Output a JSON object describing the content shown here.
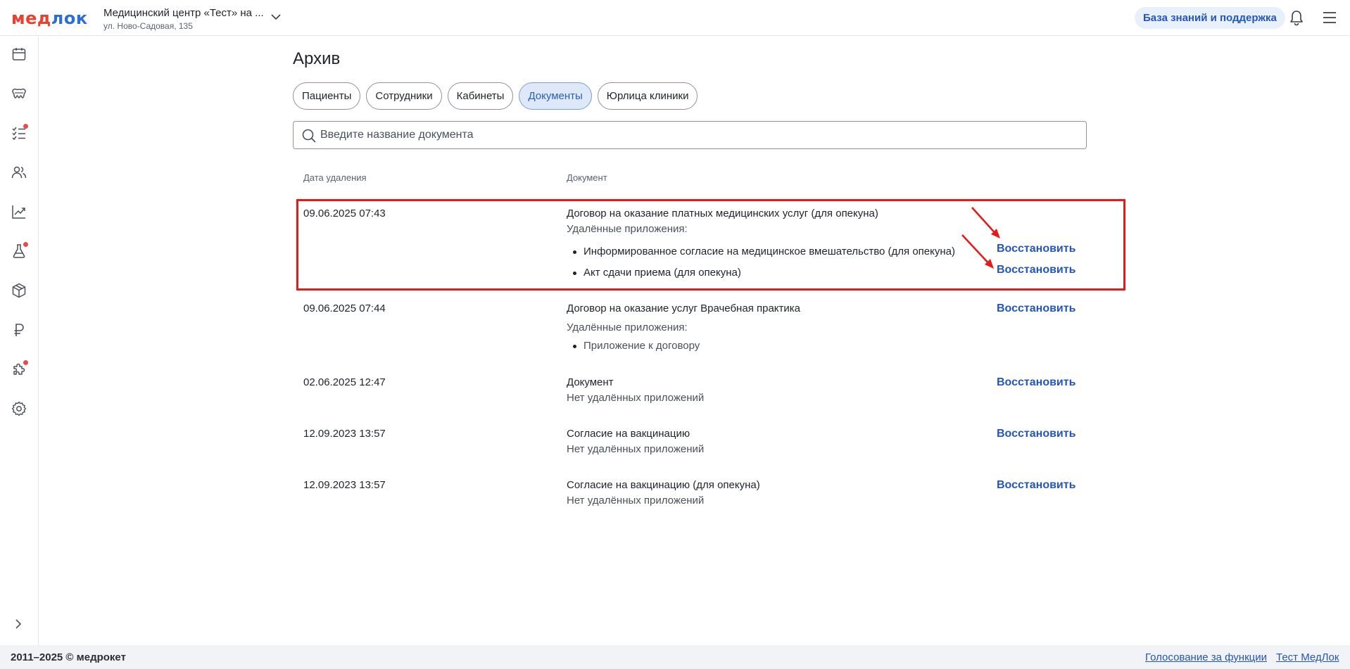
{
  "header": {
    "logo_part1": "мед",
    "logo_part2": "лок",
    "clinic_name": "Медицинский центр «Тест» на ...",
    "clinic_address": "ул. Ново-Садовая, 135",
    "kb_button": "База знаний и поддержка"
  },
  "sidebar": {
    "items": [
      {
        "icon": "calendar-icon",
        "badge": false
      },
      {
        "icon": "teeth-icon",
        "badge": false
      },
      {
        "icon": "tasks-icon",
        "badge": true
      },
      {
        "icon": "users-icon",
        "badge": false
      },
      {
        "icon": "chart-icon",
        "badge": false
      },
      {
        "icon": "flask-icon",
        "badge": true
      },
      {
        "icon": "box-icon",
        "badge": false
      },
      {
        "icon": "ruble-icon",
        "badge": false
      },
      {
        "icon": "puzzle-icon",
        "badge": true
      },
      {
        "icon": "gear-icon",
        "badge": false
      }
    ],
    "badge_color": "#ea4c4c"
  },
  "main": {
    "title": "Архив",
    "tabs": [
      "Пациенты",
      "Сотрудники",
      "Кабинеты",
      "Документы",
      "Юрлица клиники"
    ],
    "active_tab": "Документы",
    "search_placeholder": "Введите название документа",
    "columns": [
      "Дата удаления",
      "Документ"
    ],
    "restore_label": "Восстановить",
    "attachments_label": "Удалённые приложения:",
    "no_attachments_label": "Нет удалённых приложений",
    "rows": [
      {
        "date": "09.06.2025 07:43",
        "document": "Договор на оказание платных медицинских услуг (для опекуна)",
        "attachments": [
          "Информированное согласие на медицинское вмешательство (для опекуна)",
          "Акт сдачи приема (для опекуна)"
        ],
        "restore_on_attachments": true
      },
      {
        "date": "09.06.2025 07:44",
        "document": "Договор на оказание услуг Врачебная практика",
        "attachments": [
          "Приложение к договору"
        ],
        "restore_on_attachments": false
      },
      {
        "date": "02.06.2025 12:47",
        "document": "Документ",
        "attachments": []
      },
      {
        "date": "12.09.2023 13:57",
        "document": "Согласие на вакцинацию",
        "attachments": []
      },
      {
        "date": "12.09.2023 13:57",
        "document": "Согласие на вакцинацию (для опекуна)",
        "attachments": []
      }
    ]
  },
  "colors": {
    "accent": "#2456b8",
    "highlight": "#e31b1b",
    "logo_red": "#e8412f",
    "logo_blue": "#2b6fd6"
  },
  "footer": {
    "copyright": "2011–2025 © медрокет",
    "link_vote": "Голосование за функции",
    "link_test": "Тест МедЛок"
  }
}
